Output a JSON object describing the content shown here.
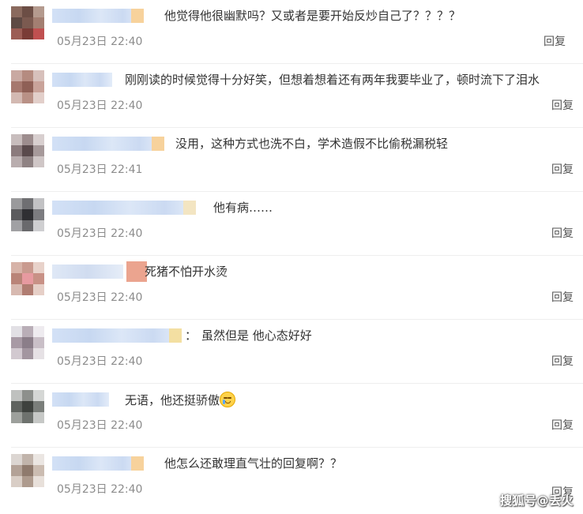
{
  "comments": [
    {
      "text": "他觉得他很幽默吗？又或者是要开始反炒自己了？？？？",
      "time": "05月23日 22:40",
      "reply": "回复"
    },
    {
      "text": "刚刚读的时候觉得十分好笑，但想着想着还有两年我要毕业了，顿时流下了泪水",
      "time": "05月23日 22:40",
      "reply": "回复"
    },
    {
      "text": "没用，这种方式也洗不白，学术造假不比偷税漏税轻",
      "time": "05月23日 22:41",
      "reply": "回复"
    },
    {
      "text": "他有病……",
      "time": "05月23日 22:40",
      "reply": "回复"
    },
    {
      "text": "死猪不怕开水烫",
      "time": "05月23日 22:40",
      "reply": "回复"
    },
    {
      "text": "虽然但是 他心态好好",
      "prefix": "：",
      "time": "05月23日 22:40",
      "reply": "回复"
    },
    {
      "text": "无语，他还挺骄傲",
      "time": "05月23日 22:40",
      "reply": "回复",
      "emoji": "crying-face-icon"
    },
    {
      "text": "他怎么还敢理直气壮的回复啊？？",
      "time": "05月23日 22:40",
      "reply": "回复"
    }
  ],
  "watermark": "搜狐号@丢火"
}
